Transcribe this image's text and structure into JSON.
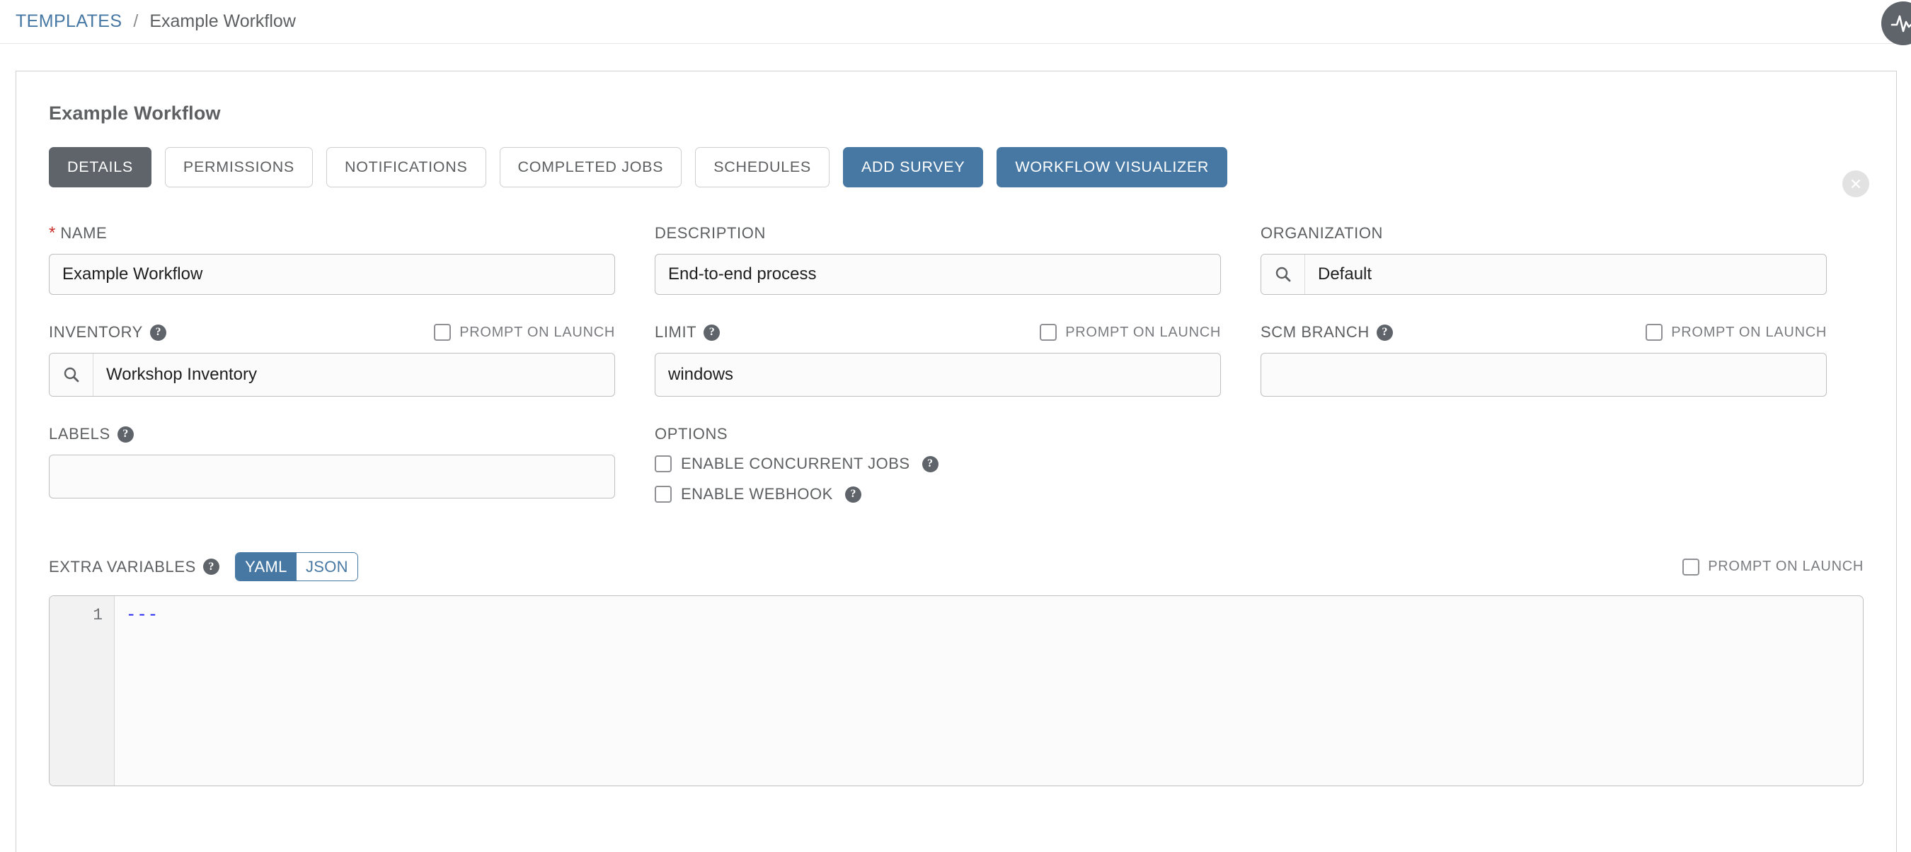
{
  "breadcrumb": {
    "root": "TEMPLATES",
    "separator": "/",
    "current": "Example Workflow",
    "activity_icon": "activity-pulse-icon"
  },
  "card": {
    "title": "Example Workflow",
    "close_icon": "close-icon"
  },
  "tabs": [
    {
      "label": "DETAILS",
      "state": "active"
    },
    {
      "label": "PERMISSIONS",
      "state": "plain"
    },
    {
      "label": "NOTIFICATIONS",
      "state": "plain"
    },
    {
      "label": "COMPLETED JOBS",
      "state": "plain"
    },
    {
      "label": "SCHEDULES",
      "state": "plain"
    },
    {
      "label": "ADD SURVEY",
      "state": "primary"
    },
    {
      "label": "WORKFLOW VISUALIZER",
      "state": "primary"
    }
  ],
  "fields": {
    "name": {
      "label": "NAME",
      "required_marker": "*",
      "value": "Example Workflow",
      "placeholder": ""
    },
    "description": {
      "label": "DESCRIPTION",
      "value": "End-to-end process",
      "placeholder": ""
    },
    "organization": {
      "label": "ORGANIZATION",
      "value": "Default",
      "placeholder": "",
      "search_icon": "search-icon"
    },
    "inventory": {
      "label": "INVENTORY",
      "value": "Workshop Inventory",
      "placeholder": "",
      "help_icon": "help-icon",
      "search_icon": "search-icon",
      "prompt_label": "PROMPT ON LAUNCH",
      "prompt_checked": false
    },
    "limit": {
      "label": "LIMIT",
      "value": "windows",
      "placeholder": "",
      "help_icon": "help-icon",
      "prompt_label": "PROMPT ON LAUNCH",
      "prompt_checked": false
    },
    "scm_branch": {
      "label": "SCM BRANCH",
      "value": "",
      "placeholder": "",
      "help_icon": "help-icon",
      "prompt_label": "PROMPT ON LAUNCH",
      "prompt_checked": false
    },
    "labels": {
      "label": "LABELS",
      "value": "",
      "placeholder": "",
      "help_icon": "help-icon"
    }
  },
  "options": {
    "label": "OPTIONS",
    "items": [
      {
        "label": "ENABLE CONCURRENT JOBS",
        "checked": false,
        "help_icon": "help-icon"
      },
      {
        "label": "ENABLE WEBHOOK",
        "checked": false,
        "help_icon": "help-icon"
      }
    ]
  },
  "extra_variables": {
    "label": "EXTRA VARIABLES",
    "help_icon": "help-icon",
    "format_yaml": "YAML",
    "format_json": "JSON",
    "selected_format": "YAML",
    "prompt_label": "PROMPT ON LAUNCH",
    "prompt_checked": false,
    "line_number": "1",
    "content": "---"
  },
  "colors": {
    "accent_blue": "#4678a3",
    "active_gray": "#5f646b",
    "required_red": "#c9302c",
    "code_blue": "#1d1df0"
  }
}
